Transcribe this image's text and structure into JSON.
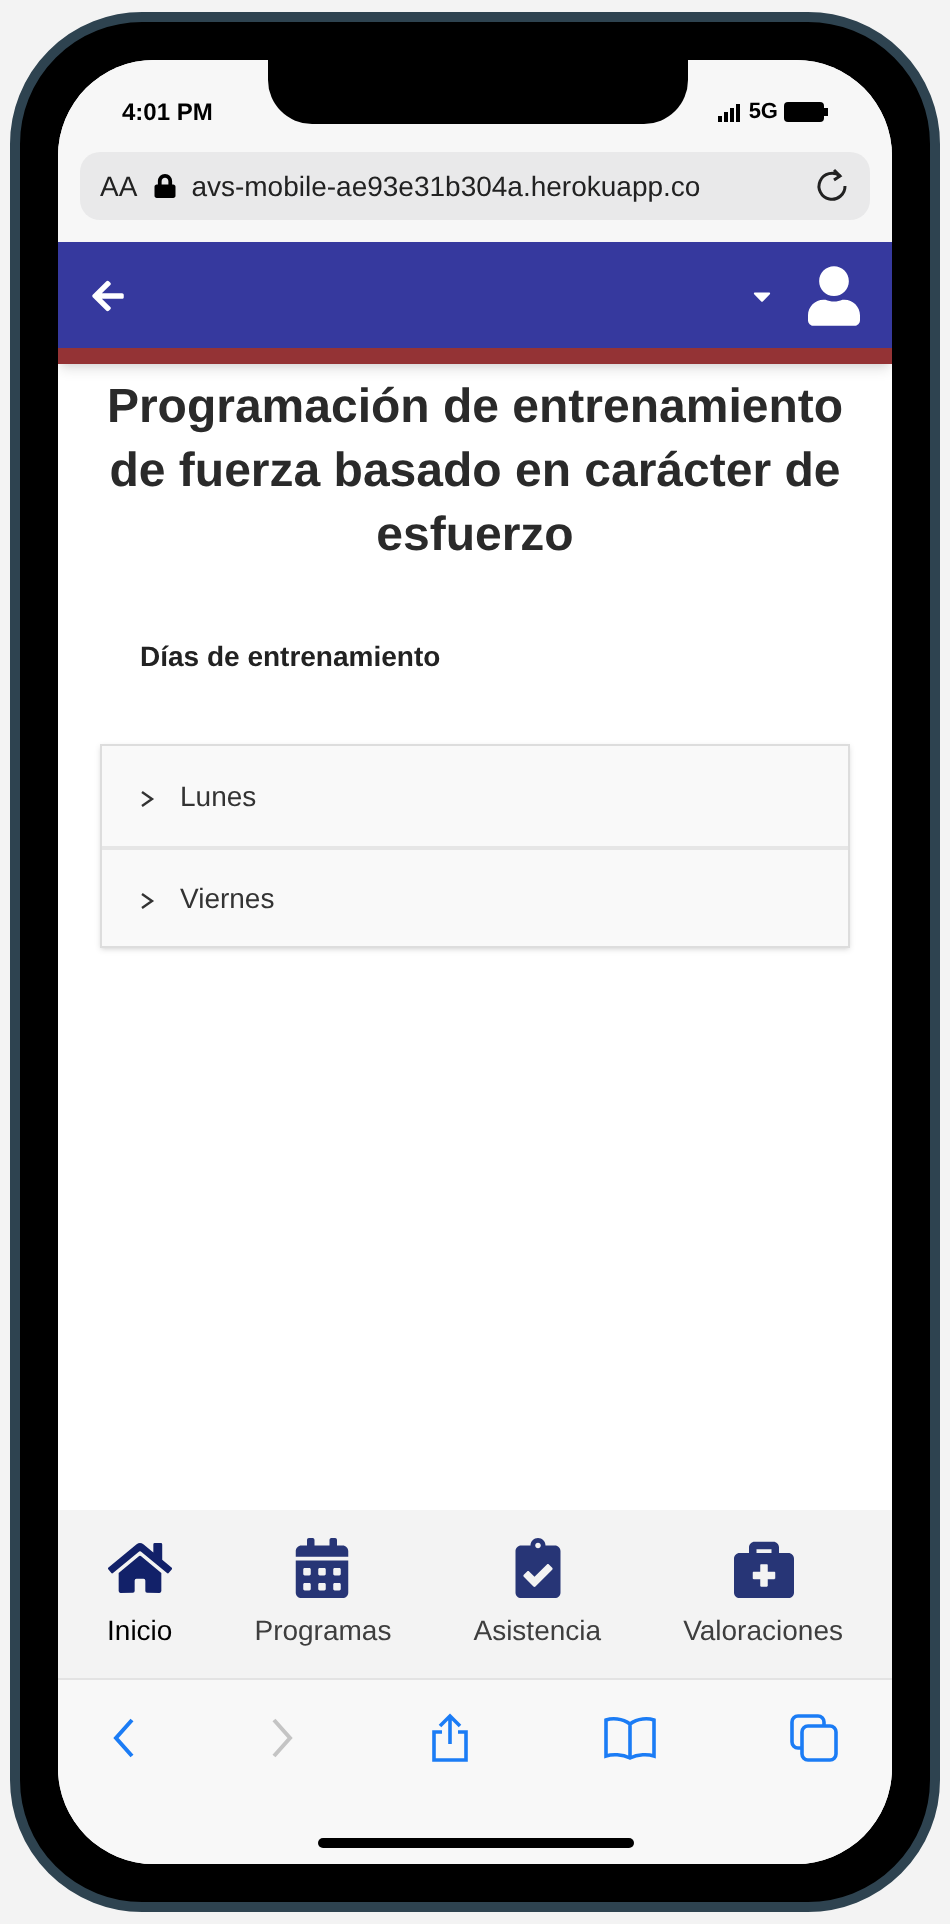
{
  "status_bar": {
    "time": "4:01 PM",
    "network": "5G"
  },
  "browser": {
    "text_size": "AA",
    "url": "avs-mobile-ae93e31b304a.herokuapp.co"
  },
  "page": {
    "title": "Programación de entrenamiento de fuerza basado en carácter de esfuerzo",
    "section_label": "Días de entrenamiento",
    "days": [
      {
        "label": "Lunes",
        "expanded": false
      },
      {
        "label": "Viernes",
        "expanded": false
      }
    ]
  },
  "bottom_nav": [
    {
      "label": "Inicio",
      "selected": true
    },
    {
      "label": "Programas",
      "selected": false
    },
    {
      "label": "Asistencia",
      "selected": false
    },
    {
      "label": "Valoraciones",
      "selected": false
    }
  ]
}
